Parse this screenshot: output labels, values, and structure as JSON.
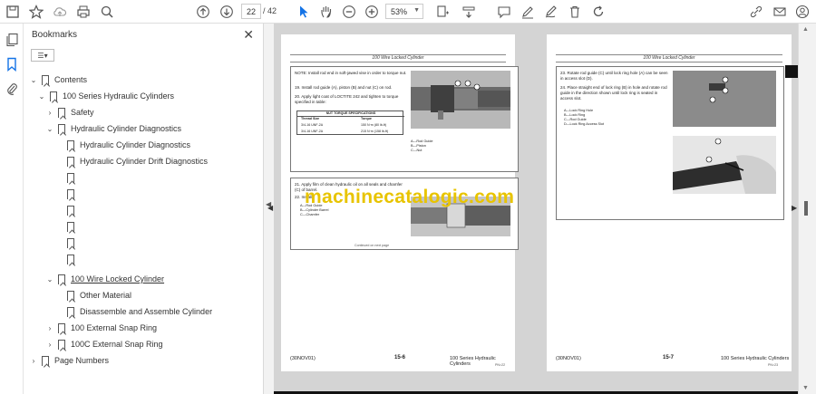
{
  "toolbar": {
    "current_page": "22",
    "total_pages": "/ 42",
    "zoom": "53%"
  },
  "bookmarks": {
    "title": "Bookmarks",
    "options_label": "☰▾",
    "items": [
      {
        "label": "Contents",
        "chev": "⌄"
      },
      {
        "label": "100 Series Hydraulic Cylinders",
        "chev": "⌄"
      },
      {
        "label": "Safety",
        "chev": "›"
      },
      {
        "label": "Hydraulic Cylinder Diagnostics",
        "chev": "⌄"
      },
      {
        "label": "Hydraulic Cylinder Diagnostics",
        "chev": ""
      },
      {
        "label": "Hydraulic Cylinder Drift Diagnostics",
        "chev": ""
      },
      {
        "label": "",
        "chev": ""
      },
      {
        "label": "",
        "chev": ""
      },
      {
        "label": "",
        "chev": ""
      },
      {
        "label": "",
        "chev": ""
      },
      {
        "label": "",
        "chev": ""
      },
      {
        "label": "",
        "chev": ""
      },
      {
        "label": "100 Wire Locked Cylinder",
        "chev": "⌄"
      },
      {
        "label": "Other Material",
        "chev": ""
      },
      {
        "label": "Disassemble and Assemble Cylinder",
        "chev": ""
      },
      {
        "label": "100 External Snap Ring",
        "chev": "›"
      },
      {
        "label": "100C External Snap Ring",
        "chev": "›"
      },
      {
        "label": "Page Numbers",
        "chev": "›"
      }
    ]
  },
  "document": {
    "watermark": "machinecatalogic.com",
    "left_page": {
      "header": "100 Wire Locked Cylinder",
      "note": "NOTE:  Install rod end in soft-jawed vise in order to torque nut.",
      "step19": "19.  Install rod guide (A), piston (B) and nut (C) on rod.",
      "step20": "20.  Apply light coat of LOCTITE 242 and tighten to torque specified in table:",
      "table_title": "NUT TORQUE SPECIFICATIONS",
      "table_head": [
        "Thread Size",
        "Torque"
      ],
      "table_rows": [
        [
          "3/4-16 UNF-2A",
          "150 N·m (80 lb-ft)"
        ],
        [
          "3/4-16 UNF-2A",
          "215 N·m (158 lb-ft)"
        ]
      ],
      "legend1": [
        "A—Rod Guide",
        "B—Piston",
        "C—Nut"
      ],
      "step21": "21.  Apply film of clean hydraulic oil on all seals and chamfer (C) of barrel.",
      "step22": "22.  Install",
      "legend2": [
        "A—Rod Guide",
        "B—Cylinder Barrel",
        "C—Chamfer"
      ],
      "continued": "Continued on next page",
      "footer_code": "(30NOV01)",
      "footer_page": "15-6",
      "footer_title": "100 Series Hydraulic Cylinders",
      "footer_sub": "PN=22"
    },
    "right_page": {
      "header": "100 Wire Locked Cylinder",
      "step23": "23.  Rotate rod guide (C) until lock ring hole (A) can be seen in access slot (D).",
      "step24": "24.  Place straight end of lock ring (B) in hole and rotate rod guide in the direction shown until lock ring is seated in access slot.",
      "legend": [
        "A—Lock Ring Hole",
        "B—Lock Ring",
        "C—Rod Guide",
        "D—Lock Ring Access Slot"
      ],
      "footer_code": "(30NOV01)",
      "footer_page": "15-7",
      "footer_title": "100 Series Hydraulic Cylinders",
      "footer_sub": "PN=23"
    }
  }
}
